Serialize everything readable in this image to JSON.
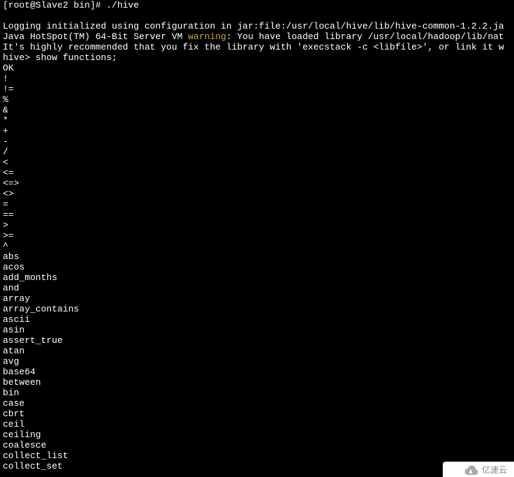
{
  "prompt": "[root@Slave2 bin]# ./hive",
  "blank1": "",
  "log_line": "Logging initialized using configuration in jar:file:/usr/local/hive/lib/hive-common-1.2.2.ja",
  "java_prefix": "Java HotSpot(TM) 64-Bit Server VM ",
  "warning_word": "warning",
  "java_suffix": ": You have loaded library /usr/local/hadoop/lib/nat",
  "rec_line": "It's highly recommended that you fix the library with 'execstack -c <libfile>', or link it w",
  "hive_cmd": "hive> show functions;",
  "ok_line": "OK",
  "functions": [
    "!",
    "!=",
    "%",
    "&",
    "*",
    "+",
    "-",
    "/",
    "<",
    "<=",
    "<=>",
    "<>",
    "=",
    "==",
    ">",
    ">=",
    "^",
    "abs",
    "acos",
    "add_months",
    "and",
    "array",
    "array_contains",
    "ascii",
    "asin",
    "assert_true",
    "atan",
    "avg",
    "base64",
    "between",
    "bin",
    "case",
    "cbrt",
    "ceil",
    "ceiling",
    "coalesce",
    "collect_list",
    "collect_set"
  ],
  "watermark_text": "亿速云"
}
